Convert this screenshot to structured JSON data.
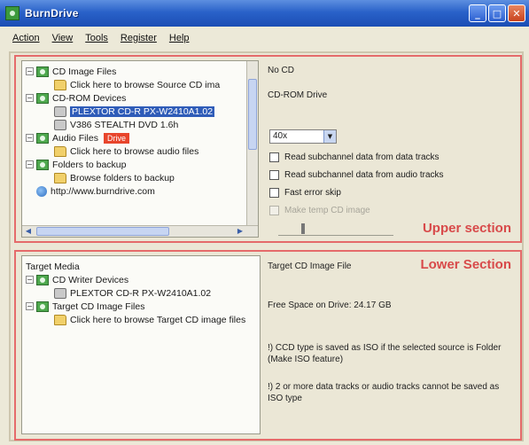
{
  "window": {
    "title": "BurnDrive"
  },
  "menu": [
    "Action",
    "View",
    "Tools",
    "Register",
    "Help"
  ],
  "upper": {
    "section_label": "Upper section",
    "tree": [
      {
        "label": "CD Image Files",
        "icon": "cd-image-icon",
        "expander": "−",
        "indent": 0
      },
      {
        "label": "Click here to browse Source CD ima",
        "icon": "folder-icon",
        "indent": 1
      },
      {
        "label": "CD-ROM Devices",
        "icon": "cd-rom-icon",
        "expander": "−",
        "indent": 0
      },
      {
        "label": "PLEXTOR CD-R   PX-W2410A1.02",
        "icon": "drive-icon",
        "indent": 1,
        "selected": true
      },
      {
        "label": "V386    STEALTH DVD    1.6h",
        "icon": "drive-icon",
        "indent": 1
      },
      {
        "label": "Audio Files",
        "icon": "audio-icon",
        "expander": "−",
        "indent": 0,
        "badge": "Drive"
      },
      {
        "label": "Click here to browse audio files",
        "icon": "folder-icon",
        "indent": 1
      },
      {
        "label": "Folders to backup",
        "icon": "folders-icon",
        "expander": "−",
        "indent": 0
      },
      {
        "label": "Browse folders to backup",
        "icon": "folder-icon",
        "indent": 1
      },
      {
        "label": "http://www.burndrive.com",
        "icon": "globe-icon",
        "indent": 0
      }
    ],
    "info_status": "No CD",
    "info_type": "CD-ROM Drive",
    "speed": "40x",
    "options": [
      {
        "label": "Read subchannel data from data tracks",
        "checked": false,
        "enabled": true
      },
      {
        "label": "Read subchannel data from audio tracks",
        "checked": false,
        "enabled": true
      },
      {
        "label": "Fast error skip",
        "checked": false,
        "enabled": true
      },
      {
        "label": "Make temp CD image",
        "checked": false,
        "enabled": false
      }
    ]
  },
  "lower": {
    "section_label": "Lower Section",
    "tree_header": "Target Media",
    "tree": [
      {
        "label": "CD Writer Devices",
        "icon": "cd-writer-icon",
        "expander": "−",
        "indent": 0
      },
      {
        "label": "PLEXTOR CD-R   PX-W2410A1.02",
        "icon": "drive-icon",
        "indent": 1
      },
      {
        "label": "Target CD Image Files",
        "icon": "target-image-icon",
        "expander": "−",
        "indent": 0
      },
      {
        "label": "Click here to browse Target CD image files",
        "icon": "folder-icon",
        "indent": 1
      }
    ],
    "info_title": "Target CD Image File",
    "free_space": "Free Space on Drive: 24.17 GB",
    "note1": "!) CCD type is saved as ISO if the selected source is Folder (Make ISO feature)",
    "note2": "!) 2 or more data tracks or audio tracks cannot be saved as ISO type"
  }
}
